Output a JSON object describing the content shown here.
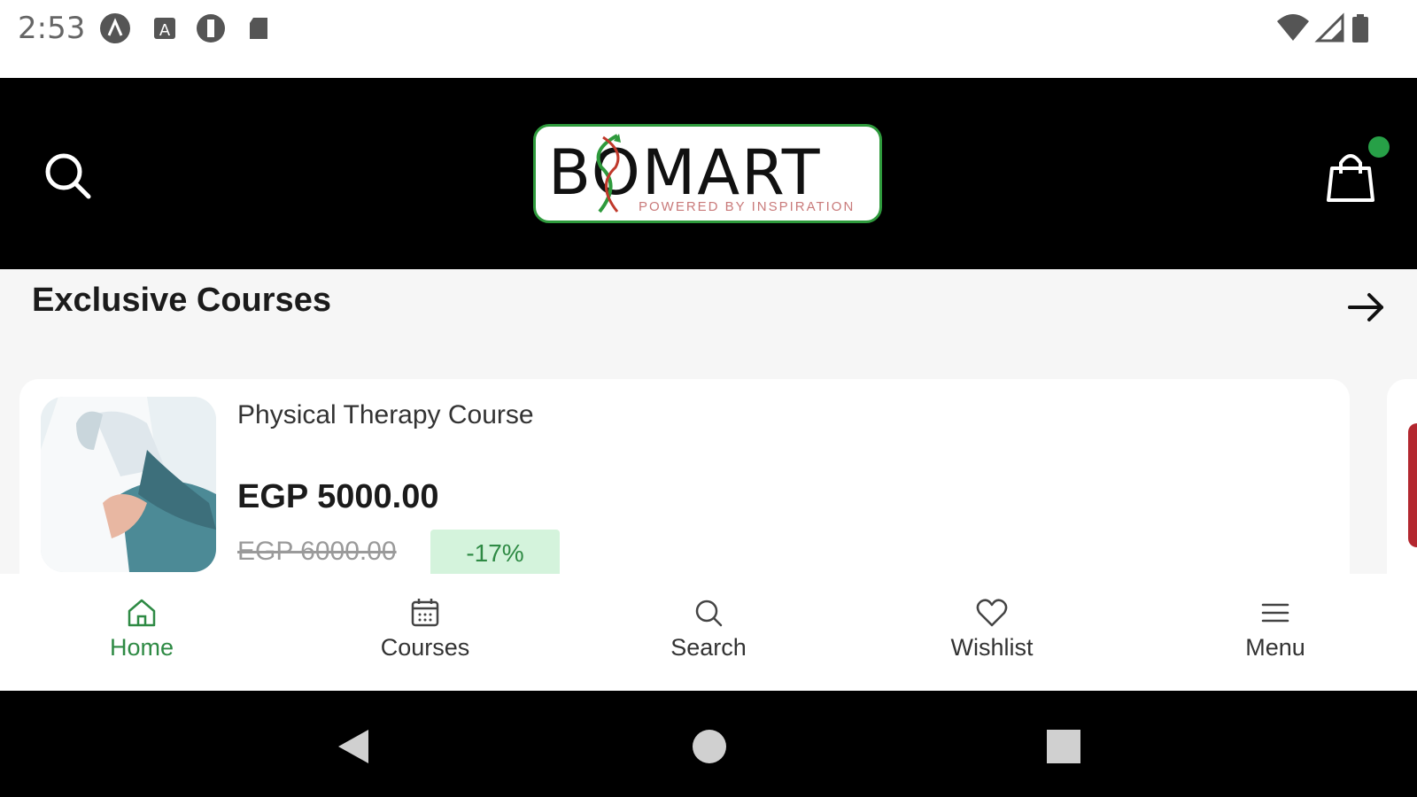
{
  "status_bar": {
    "time": "2:53"
  },
  "header": {
    "logo_text": "BOMART",
    "logo_tagline": "POWERED BY INSPIRATION",
    "accent_color": "#2e9a3c"
  },
  "section": {
    "title": "Exclusive Courses"
  },
  "courses": [
    {
      "title": "Physical Therapy Course",
      "price": "EGP 5000.00",
      "old_price": "EGP 6000.00",
      "discount": "-17%"
    }
  ],
  "bottom_nav": {
    "items": [
      {
        "label": "Home",
        "icon": "home-icon",
        "active": true
      },
      {
        "label": "Courses",
        "icon": "calendar-icon",
        "active": false
      },
      {
        "label": "Search",
        "icon": "search-icon",
        "active": false
      },
      {
        "label": "Wishlist",
        "icon": "heart-icon",
        "active": false
      },
      {
        "label": "Menu",
        "icon": "menu-icon",
        "active": false
      }
    ]
  }
}
